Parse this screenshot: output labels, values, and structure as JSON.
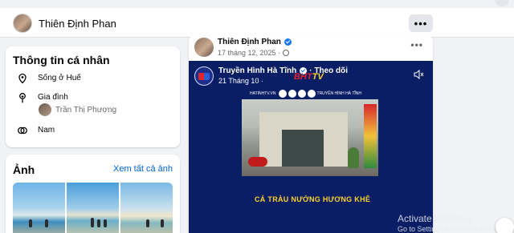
{
  "profile_bar": {
    "name": "Thiên Định Phan",
    "more_label": "•••"
  },
  "intro": {
    "title": "Thông tin cá nhân",
    "items": [
      {
        "icon": "location-pin-icon",
        "text": "Sống ở Huế"
      },
      {
        "icon": "family-heart-icon",
        "text": "Gia đình"
      },
      {
        "icon": "gender-icon",
        "text": "Nam"
      }
    ],
    "family_member": "Trần Thị Phượng"
  },
  "photos": {
    "title": "Ảnh",
    "see_all": "Xem tất cả ảnh"
  },
  "post": {
    "author": "Thiên Định Phan",
    "date": "17 tháng 12, 2025 ·",
    "more_label": "•••",
    "shared": {
      "page_name": "Truyền Hình Hà Tĩnh",
      "follow": "· Theo dõi",
      "date": "21 Tháng 10 ·",
      "logo_text": "BHT",
      "logo_accent": "TV",
      "website": "HATINHTV.VN",
      "social_handle": "TRUYỀN HÌNH HÀ TĨNH",
      "headline": "CÁ TRÀU NƯỚNG HƯƠNG KHÊ"
    }
  },
  "watermark": {
    "title": "Activate Windows",
    "subtitle": "Go to Settings to activate Windows."
  },
  "colors": {
    "link": "#0064d1",
    "verified": "#1877f2",
    "video_bg": "#0a1e66",
    "headline": "#ffd12a"
  }
}
